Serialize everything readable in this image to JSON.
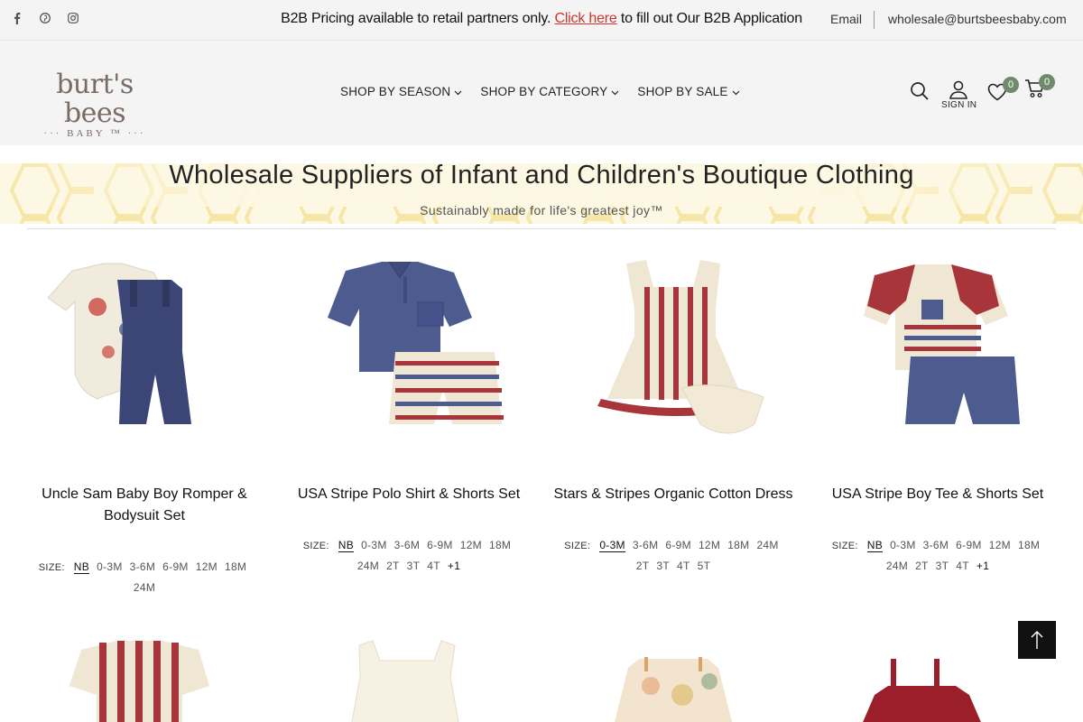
{
  "topbar": {
    "promo_text": "B2B Pricing available to retail partners only.",
    "promo_link": "Click here",
    "promo_tail": "to fill out Our B2B Application",
    "email_label": "Email",
    "email_address": "wholesale@burtsbeesbaby.com",
    "social": [
      "facebook-icon",
      "pinterest-icon",
      "instagram-icon"
    ]
  },
  "header": {
    "logo_main": "burt's bees",
    "logo_sub": "··· BABY ™ ···",
    "nav": [
      {
        "label": "SHOP BY SEASON"
      },
      {
        "label": "SHOP BY CATEGORY"
      },
      {
        "label": "SHOP BY SALE"
      }
    ],
    "signin_label": "SIGN IN",
    "wishlist_count": "0",
    "cart_count": "0"
  },
  "hero": {
    "title": "Wholesale Suppliers of Infant and Children's Boutique Clothing",
    "subtitle": "Sustainably made for life's greatest joy™"
  },
  "size_label": "SIZE:",
  "products": [
    {
      "name": "Uncle Sam Baby Boy Romper & Bodysuit Set",
      "sizes_row1": [
        "NB",
        "0-3M",
        "3-6M",
        "6-9M",
        "12M",
        "18M"
      ],
      "sizes_row2": [
        "24M"
      ],
      "more": ""
    },
    {
      "name": "USA Stripe Polo Shirt & Shorts Set",
      "sizes_row1": [
        "NB",
        "0-3M",
        "3-6M",
        "6-9M",
        "12M",
        "18M"
      ],
      "sizes_row2": [
        "24M",
        "2T",
        "3T",
        "4T"
      ],
      "more": "+1"
    },
    {
      "name": "Stars & Stripes Organic Cotton Dress",
      "sizes_row1": [
        "0-3M",
        "3-6M",
        "6-9M",
        "12M",
        "18M",
        "24M"
      ],
      "sizes_row2": [
        "2T",
        "3T",
        "4T",
        "5T"
      ],
      "more": ""
    },
    {
      "name": "USA Stripe Boy Tee & Shorts Set",
      "sizes_row1": [
        "NB",
        "0-3M",
        "3-6M",
        "6-9M",
        "12M",
        "18M"
      ],
      "sizes_row2": [
        "24M",
        "2T",
        "3T",
        "4T"
      ],
      "more": "+1"
    }
  ],
  "colors": {
    "accent_red": "#d0342c",
    "badge_green": "#6f8b6b",
    "logo_brown": "#7a6b64",
    "flag_red": "#a8353a",
    "flag_blue": "#4d5b8f",
    "cream": "#f1ebdd"
  }
}
